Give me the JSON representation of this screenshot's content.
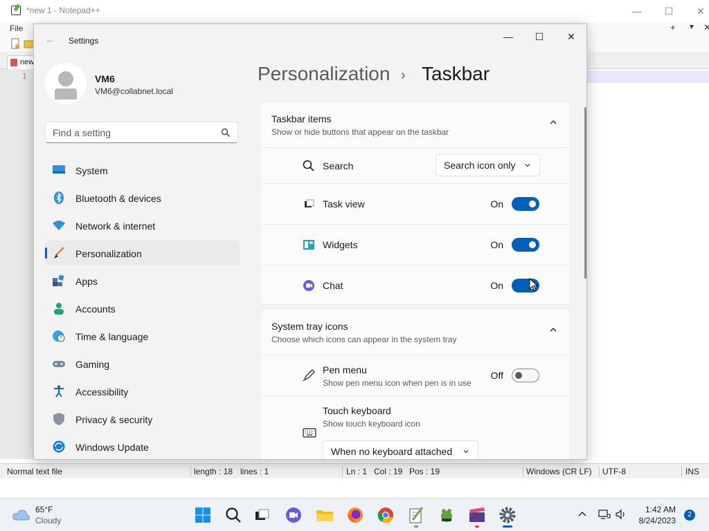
{
  "notepad": {
    "title": "*new 1 - Notepad++",
    "menu_file": "File",
    "tab_label": "new",
    "line_number": "1",
    "status": {
      "file_type": "Normal text file",
      "length": "length : 18",
      "lines": "lines : 1",
      "ln": "Ln : 1",
      "col": "Col : 19",
      "pos": "Pos : 19",
      "eol": "Windows (CR LF)",
      "encoding": "UTF-8",
      "mode": "INS"
    }
  },
  "settings": {
    "app_title": "Settings",
    "user": {
      "name": "VM6",
      "email": "VM6@collabnet.local"
    },
    "search": {
      "placeholder": "Find a setting"
    },
    "nav": [
      {
        "label": "System",
        "icon": "monitor-icon"
      },
      {
        "label": "Bluetooth & devices",
        "icon": "bluetooth-icon"
      },
      {
        "label": "Network & internet",
        "icon": "wifi-icon"
      },
      {
        "label": "Personalization",
        "icon": "paintbrush-icon",
        "active": true
      },
      {
        "label": "Apps",
        "icon": "apps-icon"
      },
      {
        "label": "Accounts",
        "icon": "person-icon"
      },
      {
        "label": "Time & language",
        "icon": "globe-clock-icon"
      },
      {
        "label": "Gaming",
        "icon": "gamepad-icon"
      },
      {
        "label": "Accessibility",
        "icon": "accessibility-icon"
      },
      {
        "label": "Privacy & security",
        "icon": "shield-icon"
      },
      {
        "label": "Windows Update",
        "icon": "update-icon"
      }
    ],
    "breadcrumb": {
      "parent": "Personalization",
      "separator": "›",
      "current": "Taskbar"
    },
    "taskbar_items": {
      "title": "Taskbar items",
      "subtitle": "Show or hide buttons that appear on the taskbar",
      "search": {
        "label": "Search",
        "value": "Search icon only"
      },
      "task_view": {
        "label": "Task view",
        "state": "On"
      },
      "widgets": {
        "label": "Widgets",
        "state": "On"
      },
      "chat": {
        "label": "Chat",
        "state": "On"
      }
    },
    "system_tray": {
      "title": "System tray icons",
      "subtitle": "Choose which icons can appear in the system tray",
      "pen_menu": {
        "label": "Pen menu",
        "description": "Show pen menu icon when pen is in use",
        "state": "Off"
      },
      "touch_keyboard": {
        "label": "Touch keyboard",
        "description": "Show touch keyboard icon",
        "value": "When no keyboard attached"
      }
    }
  },
  "taskbar": {
    "weather": {
      "temp": "65°F",
      "condition": "Cloudy"
    },
    "clock": {
      "time": "1:42 AM",
      "date": "8/24/2023"
    },
    "notification_count": "2"
  },
  "colors": {
    "accent": "#005fb8",
    "window_bg": "#f3f3f3",
    "card_bg": "#fbfbfb"
  }
}
